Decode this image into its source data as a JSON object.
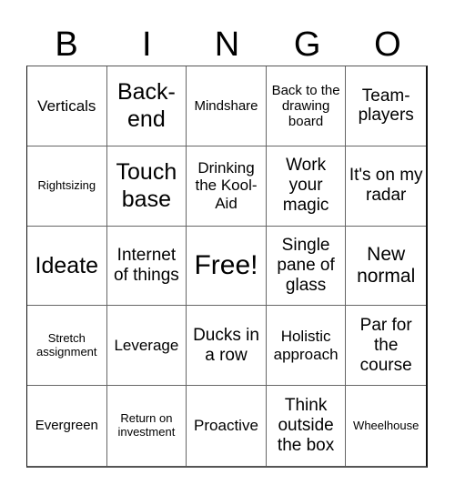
{
  "header": [
    "B",
    "I",
    "N",
    "G",
    "O"
  ],
  "cells": [
    "Verticals",
    "Back-end",
    "Mindshare",
    "Back to the drawing board",
    "Team-players",
    "Rightsizing",
    "Touch base",
    "Drinking the Kool-Aid",
    "Work your magic",
    "It's on my radar",
    "Ideate",
    "Internet of things",
    "Free!",
    "Single pane of glass",
    "New normal",
    "Stretch assignment",
    "Leverage",
    "Ducks in a row",
    "Holistic approach",
    "Par for the course",
    "Evergreen",
    "Return on investment",
    "Proactive",
    "Think outside the box",
    "Wheelhouse"
  ]
}
